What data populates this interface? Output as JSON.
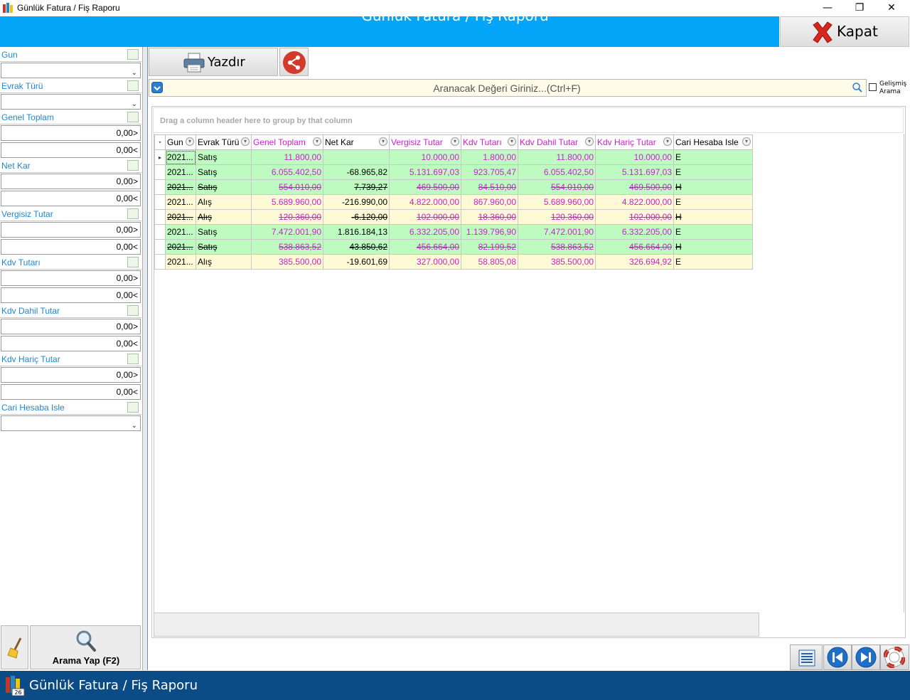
{
  "window": {
    "title": "Günlük Fatura / Fiş Raporu",
    "minimize": "—",
    "restore": "❐",
    "close": "✕"
  },
  "header": {
    "title": "Günlük Fatura / Fiş Raporu",
    "close_label": "Kapat"
  },
  "filters": {
    "gun": {
      "label": "Gun"
    },
    "evrak_turu": {
      "label": "Evrak Türü"
    },
    "genel_toplam": {
      "label": "Genel Toplam",
      "min": "0,00>",
      "max": "0,00<"
    },
    "net_kar": {
      "label": "Net Kar",
      "min": "0,00>",
      "max": "0,00<"
    },
    "vergisiz_tutar": {
      "label": "Vergisiz Tutar",
      "min": "0,00>",
      "max": "0,00<"
    },
    "kdv_tutari": {
      "label": "Kdv Tutarı",
      "min": "0,00>",
      "max": "0,00<"
    },
    "kdv_dahil_tutar": {
      "label": "Kdv Dahil Tutar",
      "min": "0,00>",
      "max": "0,00<"
    },
    "kdv_haric_tutar": {
      "label": "Kdv Hariç Tutar",
      "min": "0,00>",
      "max": "0,00<"
    },
    "cari_hesaba_isle": {
      "label": "Cari Hesaba Isle"
    },
    "search_label": "Arama Yap (F2)"
  },
  "toolbar": {
    "print_label": "Yazdır"
  },
  "search": {
    "placeholder": "Aranacak Değeri Giriniz...(Ctrl+F)",
    "advanced_line1": "Gelişmiş",
    "advanced_line2": "Arama"
  },
  "grid": {
    "group_hint": "Drag a column header here to group by that column",
    "columns": [
      "Gun",
      "Evrak Türü",
      "Genel Toplam",
      "Net Kar",
      "Vergisiz Tutar",
      "Kdv Tutarı",
      "Kdv Dahil Tutar",
      "Kdv Hariç Tutar",
      "Cari Hesaba Isle"
    ],
    "rows": [
      {
        "gun": "2021...",
        "evrak": "Satış",
        "genel": "11.800,00",
        "net": "",
        "vergisiz": "10.000,00",
        "kdv": "1.800,00",
        "dahil": "11.800,00",
        "haric": "10.000,00",
        "cari": "E",
        "type": "sat",
        "strike": false
      },
      {
        "gun": "2021...",
        "evrak": "Satış",
        "genel": "6.055.402,50",
        "net": "-68.965,82",
        "vergisiz": "5.131.697,03",
        "kdv": "923.705,47",
        "dahil": "6.055.402,50",
        "haric": "5.131.697,03",
        "cari": "E",
        "type": "sat",
        "strike": false
      },
      {
        "gun": "2021...",
        "evrak": "Satış",
        "genel": "554.010,00",
        "net": "7.739,27",
        "vergisiz": "469.500,00",
        "kdv": "84.510,00",
        "dahil": "554.010,00",
        "haric": "469.500,00",
        "cari": "H",
        "type": "sat",
        "strike": true
      },
      {
        "gun": "2021...",
        "evrak": "Alış",
        "genel": "5.689.960,00",
        "net": "-216.990,00",
        "vergisiz": "4.822.000,00",
        "kdv": "867.960,00",
        "dahil": "5.689.960,00",
        "haric": "4.822.000,00",
        "cari": "E",
        "type": "alis",
        "strike": false
      },
      {
        "gun": "2021...",
        "evrak": "Alış",
        "genel": "120.360,00",
        "net": "-6.120,00",
        "vergisiz": "102.000,00",
        "kdv": "18.360,00",
        "dahil": "120.360,00",
        "haric": "102.000,00",
        "cari": "H",
        "type": "alis",
        "strike": true
      },
      {
        "gun": "2021...",
        "evrak": "Satış",
        "genel": "7.472.001,90",
        "net": "1.816.184,13",
        "vergisiz": "6.332.205,00",
        "kdv": "1.139.796,90",
        "dahil": "7.472.001,90",
        "haric": "6.332.205,00",
        "cari": "E",
        "type": "sat",
        "strike": false
      },
      {
        "gun": "2021...",
        "evrak": "Satış",
        "genel": "538.863,52",
        "net": "43.850,62",
        "vergisiz": "456.664,00",
        "kdv": "82.199,52",
        "dahil": "538.863,52",
        "haric": "456.664,00",
        "cari": "H",
        "type": "sat",
        "strike": true
      },
      {
        "gun": "2021...",
        "evrak": "Alış",
        "genel": "385.500,00",
        "net": "-19.601,69",
        "vergisiz": "327.000,00",
        "kdv": "58.805,08",
        "dahil": "385.500,00",
        "haric": "326.694,92",
        "cari": "E",
        "type": "alis",
        "strike": false
      }
    ]
  },
  "taskbar": {
    "title": "Günlük Fatura / Fiş Raporu",
    "badge": "26"
  },
  "colors": {
    "header": "#02a5f7",
    "accent_pink": "#d41ad4",
    "row_satis": "#bdfbc1",
    "row_alis": "#fffad6",
    "label_blue": "#1c87d6",
    "taskbar": "#0b4b86"
  },
  "icons": [
    "app-icon",
    "close-x-icon",
    "printer-icon",
    "share-icon",
    "search-icon",
    "magnifier-icon",
    "broom-icon",
    "columns-icon",
    "first-page-icon",
    "last-page-icon",
    "help-lifebuoy-icon",
    "filter-icon",
    "clear-filter-icon",
    "chevron-down-icon"
  ]
}
